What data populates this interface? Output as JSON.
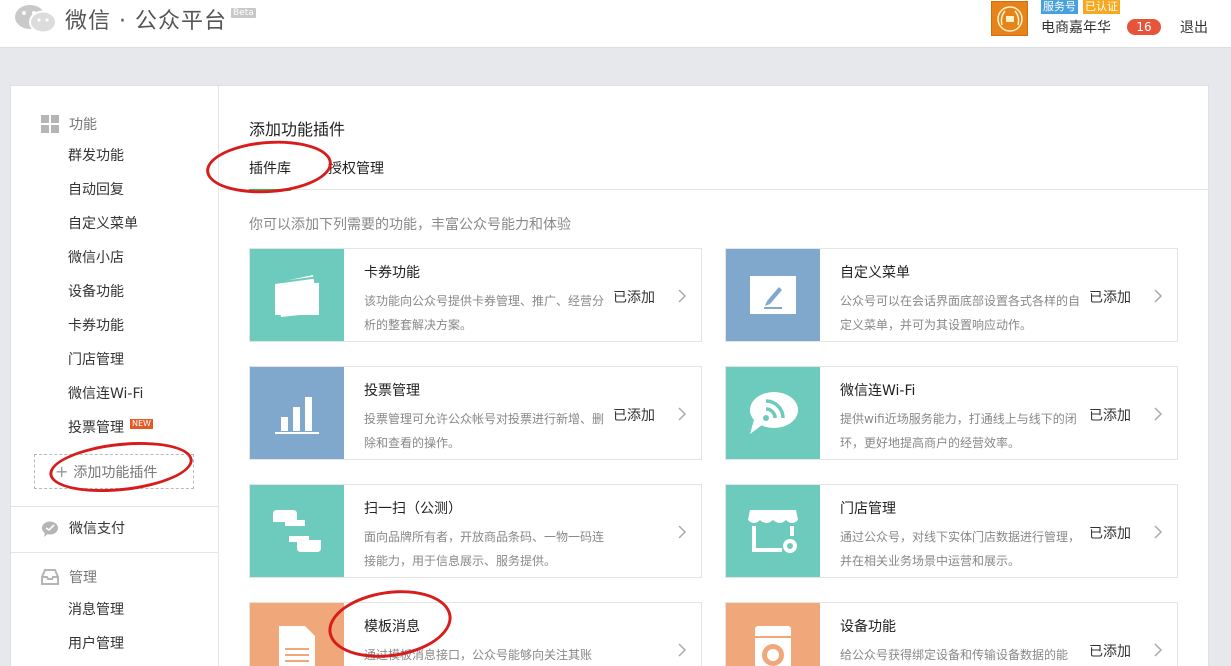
{
  "header": {
    "logo_title": "微信 · 公众平台",
    "beta": "Beta",
    "badge_service": "服务号",
    "badge_verified": "已认证",
    "account_name": "电商嘉年华",
    "message_count": "16",
    "logout": "退出"
  },
  "sidebar": {
    "function_section": "功能",
    "function_items": [
      "群发功能",
      "自动回复",
      "自定义菜单",
      "微信小店",
      "设备功能",
      "卡券功能",
      "门店管理",
      "微信连Wi-Fi",
      "投票管理"
    ],
    "new_tag": "NEW",
    "add_plugin": "添加功能插件",
    "pay": "微信支付",
    "manage_section": "管理",
    "manage_items": [
      "消息管理",
      "用户管理"
    ]
  },
  "main": {
    "title": "添加功能插件",
    "tabs": [
      "插件库",
      "授权管理"
    ],
    "subtitle": "你可以添加下列需要的功能，丰富公众号能力和体验",
    "cards": [
      {
        "title": "卡券功能",
        "desc": "该功能向公众号提供卡券管理、推广、经营分析的整套解决方案。",
        "status": "已添加",
        "color": "#6ccbbd",
        "icon": "card-icon"
      },
      {
        "title": "自定义菜单",
        "desc": "公众号可以在会话界面底部设置各式各样的自定义菜单，并可为其设置响应动作。",
        "status": "已添加",
        "color": "#7fa8cc",
        "icon": "pencil-icon"
      },
      {
        "title": "投票管理",
        "desc": "投票管理可允许公众帐号对投票进行新增、删除和查看的操作。",
        "status": "已添加",
        "color": "#7fa8cc",
        "icon": "bar-chart-icon"
      },
      {
        "title": "微信连Wi-Fi",
        "desc": "提供wifi近场服务能力，打通线上与线下的闭环，更好地提高商户的经营效率。",
        "status": "已添加",
        "color": "#6ccbbd",
        "icon": "wifi-icon"
      },
      {
        "title": "扫一扫（公测）",
        "desc": "面向品牌所有者，开放商品条码、一物一码连接能力，用于信息展示、服务提供。",
        "status": "",
        "color": "#6ccbbd",
        "icon": "scan-icon"
      },
      {
        "title": "门店管理",
        "desc": "通过公众号，对线下实体门店数据进行管理，并在相关业务场景中运营和展示。",
        "status": "已添加",
        "color": "#6ccbbd",
        "icon": "store-icon"
      },
      {
        "title": "模板消息",
        "desc": "通过模板消息接口，公众号能够向关注其账",
        "status": "",
        "color": "#f0a77a",
        "icon": "document-icon"
      },
      {
        "title": "设备功能",
        "desc": "给公众号获得绑定设备和传输设备数据的能",
        "status": "已添加",
        "color": "#f0a77a",
        "icon": "washer-icon"
      }
    ]
  }
}
